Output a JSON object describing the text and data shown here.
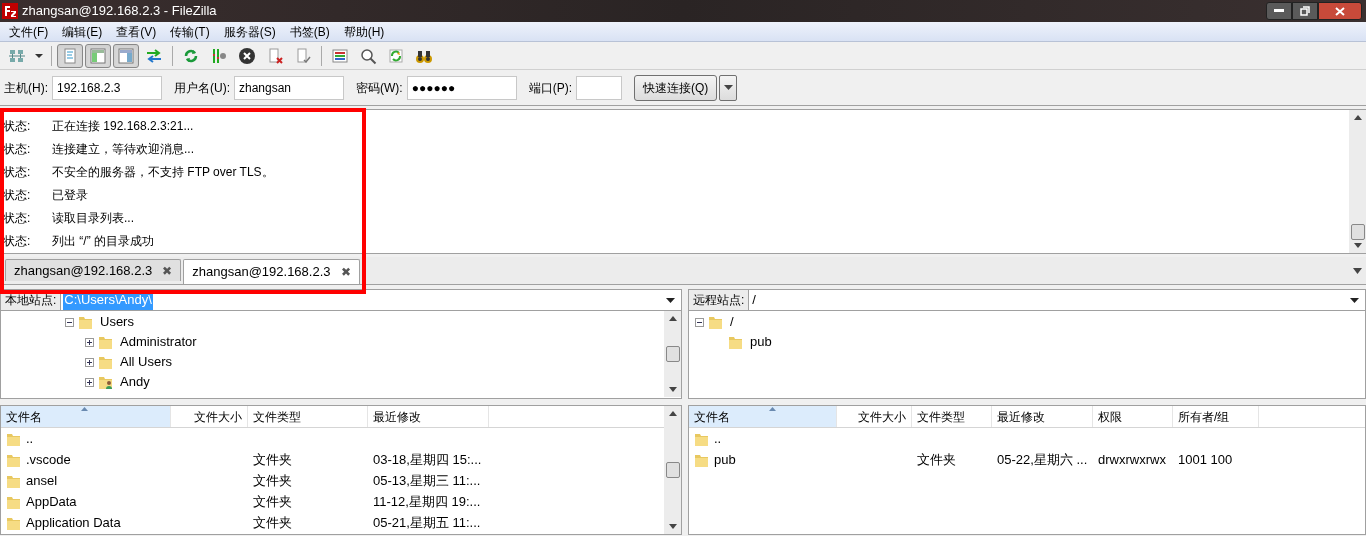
{
  "window": {
    "title": "zhangsan@192.168.2.3 - FileZilla"
  },
  "menu": [
    "文件(F)",
    "编辑(E)",
    "查看(V)",
    "传输(T)",
    "服务器(S)",
    "书签(B)",
    "帮助(H)"
  ],
  "toolbar": [
    {
      "kind": "site-manager"
    },
    {
      "kind": "dropdown"
    },
    {
      "kind": "sep"
    },
    {
      "kind": "log",
      "pressed": true
    },
    {
      "kind": "local-tree",
      "pressed": true
    },
    {
      "kind": "remote-tree",
      "pressed": true
    },
    {
      "kind": "transfer"
    },
    {
      "kind": "sep"
    },
    {
      "kind": "refresh"
    },
    {
      "kind": "filter"
    },
    {
      "kind": "cancel"
    },
    {
      "kind": "disconnect"
    },
    {
      "kind": "reconnect"
    },
    {
      "kind": "sep"
    },
    {
      "kind": "queue"
    },
    {
      "kind": "search"
    },
    {
      "kind": "sync"
    },
    {
      "kind": "find"
    }
  ],
  "quickconnect": {
    "fields": [
      {
        "label": "主机(H):",
        "value": "192.168.2.3"
      },
      {
        "label": "用户名(U):",
        "value": "zhangsan"
      },
      {
        "label": "密码(W):",
        "value": "●●●●●●"
      },
      {
        "label": "端口(P):"
      }
    ],
    "button": "快速连接(Q)"
  },
  "log": [
    {
      "label": "状态:",
      "message": "正在连接 192.168.2.3:21..."
    },
    {
      "label": "状态:",
      "message": "连接建立，等待欢迎消息..."
    },
    {
      "label": "状态:",
      "message": "不安全的服务器，不支持 FTP over TLS。"
    },
    {
      "label": "状态:",
      "message": "已登录"
    },
    {
      "label": "状态:",
      "message": "读取目录列表..."
    },
    {
      "label": "状态:",
      "message": "列出 “/” 的目录成功"
    }
  ],
  "tabs": [
    {
      "label": "zhangsan@192.168.2.3",
      "close": "✖",
      "selected": false
    },
    {
      "label": "zhangsan@192.168.2.3",
      "close": "✖",
      "selected": true
    }
  ],
  "local": {
    "site_label": "本地站点:",
    "path": "C:\\Users\\Andy\\",
    "tree": [
      {
        "label": "Users",
        "expanded": true,
        "children": [
          {
            "label": "Administrator",
            "expanded": false
          },
          {
            "label": "All Users",
            "expanded": false
          },
          {
            "label": "Andy",
            "expanded": false,
            "kind": "user"
          }
        ]
      }
    ],
    "columns": [
      "文件名",
      "文件大小",
      "文件类型",
      "最近修改"
    ],
    "rows": [
      {
        "name": ".."
      },
      {
        "name": ".vscode",
        "type": "文件夹",
        "modified": "03-18,星期四 15:..."
      },
      {
        "name": "ansel",
        "type": "文件夹",
        "modified": "05-13,星期三 11:..."
      },
      {
        "name": "AppData",
        "type": "文件夹",
        "modified": "11-12,星期四 19:..."
      },
      {
        "name": "Application Data",
        "type": "文件夹",
        "modified": "05-21,星期五 11:..."
      }
    ]
  },
  "remote": {
    "site_label": "远程站点:",
    "path": "/",
    "tree": [
      {
        "label": "/",
        "expanded": true,
        "children": [
          {
            "label": "pub"
          }
        ]
      }
    ],
    "columns": [
      "文件名",
      "文件大小",
      "文件类型",
      "最近修改",
      "权限",
      "所有者/组"
    ],
    "rows": [
      {
        "name": ".."
      },
      {
        "name": "pub",
        "type": "文件夹",
        "modified": "05-22,星期六 ...",
        "permissions": "drwxrwxrwx",
        "owner": "1001 100"
      }
    ]
  }
}
